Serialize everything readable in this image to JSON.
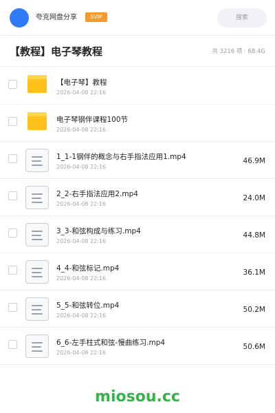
{
  "header": {
    "user_name": "夸克网盘分享",
    "badge": "SVIP",
    "search_placeholder": "搜索",
    "avatar_color": "#2f7bf5"
  },
  "folder": {
    "title": "【教程】电子琴教程",
    "meta": "共 3216 项 · 68.4G"
  },
  "items": [
    {
      "type": "folder",
      "icon": "folder-icon",
      "name": "【电子琴】教程",
      "date": "2026-04-08 22:16",
      "size": ""
    },
    {
      "type": "folder",
      "icon": "folder-icon",
      "name": "电子琴钢伴课程100节",
      "date": "2026-04-08 22:16",
      "size": ""
    },
    {
      "type": "file",
      "icon": "file-icon",
      "name": "1_1-1钢伴的概念与右手指法应用1.mp4",
      "date": "2026-04-08 22:16",
      "size": "46.9M"
    },
    {
      "type": "file",
      "icon": "file-icon",
      "name": "2_2-右手指法应用2.mp4",
      "date": "2026-04-08 22:16",
      "size": "24.0M"
    },
    {
      "type": "file",
      "icon": "file-icon",
      "name": "3_3-和弦构成与练习.mp4",
      "date": "2026-04-08 22:16",
      "size": "44.8M"
    },
    {
      "type": "file",
      "icon": "file-icon",
      "name": "4_4-和弦标记.mp4",
      "date": "2026-04-08 22:16",
      "size": "36.1M"
    },
    {
      "type": "file",
      "icon": "file-icon",
      "name": "5_5-和弦转位.mp4",
      "date": "2026-04-08 22:16",
      "size": "50.2M"
    },
    {
      "type": "file",
      "icon": "file-icon",
      "name": "6_6-左手柱式和弦-慢曲练习.mp4",
      "date": "2026-04-08 22:16",
      "size": "50.6M"
    }
  ],
  "watermark": "miosou.cc",
  "colors": {
    "folder": "#ffc21c",
    "badge": "#f39a2a",
    "watermark": "#35b34a"
  }
}
